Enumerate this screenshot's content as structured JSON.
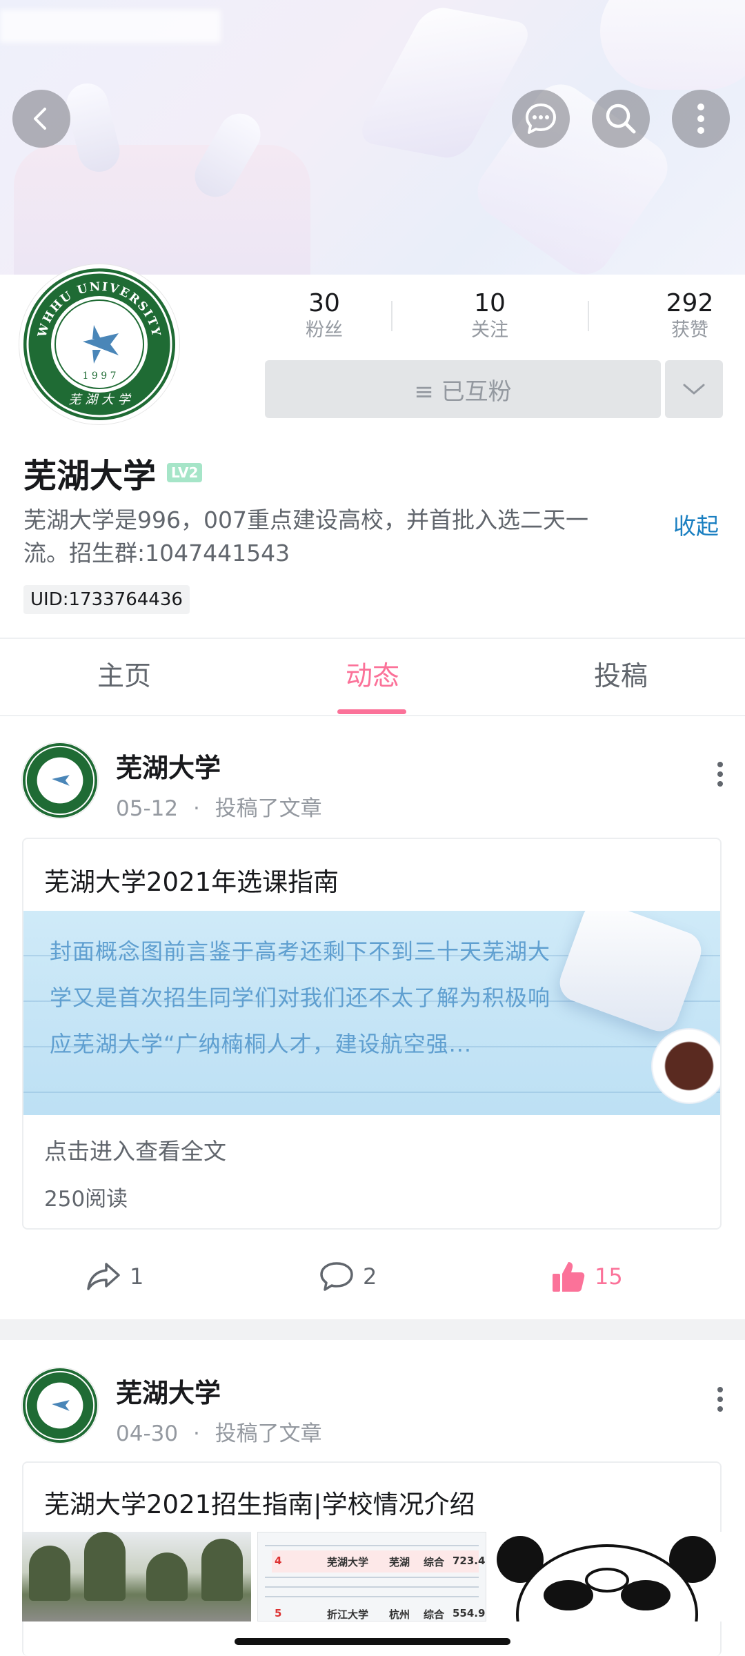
{
  "stats": {
    "followers_count": "30",
    "followers_label": "粉丝",
    "following_count": "10",
    "following_label": "关注",
    "likes_count": "292",
    "likes_label": "获赞"
  },
  "profile": {
    "mutual_label": "≡ 已互粉",
    "name": "芜湖大学",
    "level": "LV2",
    "bio": "芜湖大学是996，007重点建设高校，并首批入选二天一流。招生群:1047441543",
    "collapse_label": "收起",
    "uid": "UID:1733764436"
  },
  "logo": {
    "ring_text": "WHHU UNIVERSITY",
    "year": "1 9 9 7",
    "script_text": "芜 湖 大 学"
  },
  "tabs": [
    {
      "label": "主页",
      "active": false
    },
    {
      "label": "动态",
      "active": true
    },
    {
      "label": "投稿",
      "active": false
    }
  ],
  "posts": [
    {
      "author": "芜湖大学",
      "date": "05-12",
      "separator": "·",
      "action": "投稿了文章",
      "title": "芜湖大学2021年选课指南",
      "excerpt": "封面概念图前言鉴于高考还剩下不到三十天芜湖大学又是首次招生同学们对我们还不太了解为积极响应芜湖大学“广纳楠桐人才，建设航空强...",
      "link_label": "点击进入查看全文",
      "reads": "250阅读",
      "shares": "1",
      "comments": "2",
      "likes": "15"
    },
    {
      "author": "芜湖大学",
      "date": "04-30",
      "separator": "·",
      "action": "投稿了文章",
      "title": "芜湖大学2021招生指南|学校情况介绍",
      "table_rows": [
        {
          "rank": "4",
          "name": "芜湖大学",
          "city": "芜湖",
          "type": "综合",
          "score": "723.4"
        },
        {
          "rank": "5",
          "name": "折江大学",
          "city": "杭州",
          "type": "综合",
          "score": "554.9"
        }
      ]
    }
  ],
  "colors": {
    "accent_pink": "#fb7299",
    "link_blue": "#1a7fc1",
    "logo_green": "#1f6b34"
  }
}
